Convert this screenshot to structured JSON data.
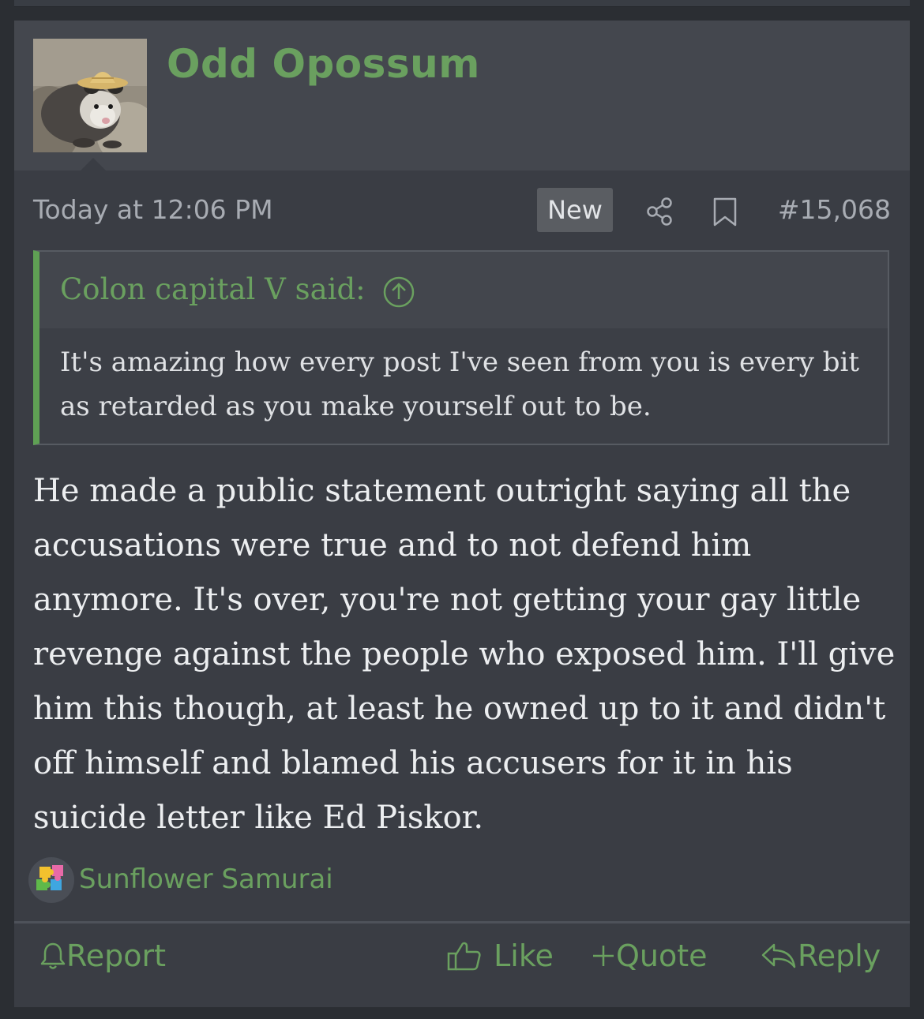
{
  "post": {
    "author": "Odd Opossum",
    "timestamp": "Today at 12:06 PM",
    "new_badge": "New",
    "post_number": "#15,068",
    "icons": {
      "share": "share-icon",
      "bookmark": "bookmark-icon",
      "quote_jump": "arrow-up-circle-icon"
    }
  },
  "quote": {
    "attribution": "Colon capital V said:",
    "text": "It's amazing how every post I've seen from you is every bit as retarded as you make yourself out to be."
  },
  "message": {
    "text": "He made a public statement outright saying all the accusations were true and to not defend him anymore. It's over, you're not getting your gay little revenge against the people who exposed him. I'll give him this though, at least he owned up to it and didn't off himself and blamed his accusers for it in his suicide letter like Ed Piskor."
  },
  "reactions": {
    "user": "Sunflower Samurai",
    "icon": "puzzle-reaction-icon"
  },
  "actions": {
    "report": "Report",
    "like": "Like",
    "quote": "Quote",
    "reply": "Reply"
  },
  "colors": {
    "accent_green": "#6aa05f",
    "quote_border": "#5fa054",
    "post_bg": "#3a3d44",
    "header_bg": "#44474e",
    "page_bg": "#2b2e33"
  }
}
